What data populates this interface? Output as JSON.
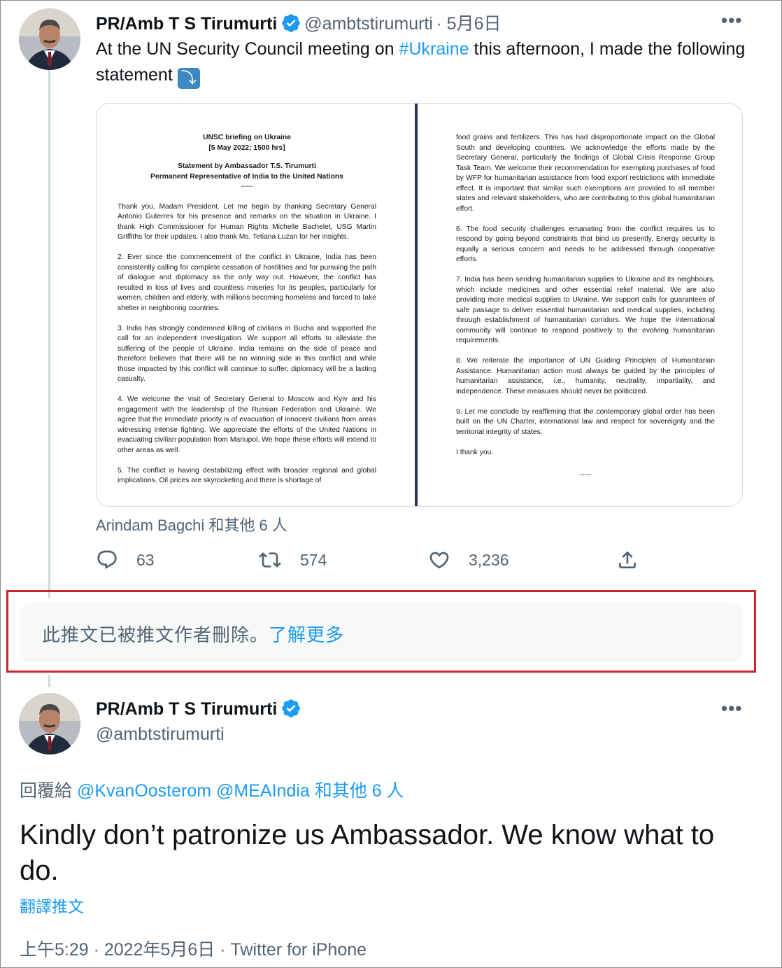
{
  "tweet1": {
    "name": "PR/Amb T S Tirumurti",
    "handle": "@ambtstirumurti",
    "date": "· 5月6日",
    "text_before": "At the UN Security Council meeting on ",
    "hashtag": "#Ukraine",
    "text_after": " this afternoon, I made the following statement ",
    "emoji": "⤵️",
    "tagged": "Arindam Bagchi 和其他 6 人",
    "replies": "63",
    "retweets": "574",
    "likes": "3,236",
    "icons": [
      "verified-badge-icon",
      "more-icon",
      "reply-icon",
      "retweet-icon",
      "like-icon",
      "share-icon"
    ]
  },
  "document": {
    "left": {
      "heading1": "UNSC briefing on Ukraine",
      "heading2": "[5 May 2022; 1500 hrs]",
      "heading3": "Statement by Ambassador T.S. Tirumurti",
      "heading4": "Permanent Representative of India to the United Nations",
      "dash": "-----",
      "p1": "        Thank you, Madam President. Let me begin by thanking Secretary General Antonio Guterres for his presence and remarks on the situation in Ukraine. I thank High Commissioner for Human Rights Michelle Bachelet, USG Martin Griffiths for their updates. I also thank Ms. Tetiana Luzan for her insights.",
      "p2": "2.      Ever since the commencement of the conflict in Ukraine, India has been consistently calling for complete cessation of hostilities and for pursuing the path of dialogue and diplomacy as the only way out. However, the conflict has resulted in loss of lives and countless miseries for its peoples, particularly for women, children and elderly, with millions becoming homeless and forced to take shelter in neighboring countries.",
      "p3": "3.      India has strongly condemned killing of civilians in Bucha and supported the call for an independent investigation. We support all efforts to alleviate the suffering of the people of Ukraine. India remains on the side of peace and therefore believes that there will be no winning side in this conflict and while those impacted by this conflict will continue to suffer, diplomacy will be a lasting casualty.",
      "p4": "4.      We welcome the visit of Secretary General to Moscow and Kyiv and his engagement with the leadership of the Russian Federation and Ukraine. We agree that the immediate priority is of evacuation of innocent civilians from areas witnessing intense fighting. We appreciate the efforts of the United Nations in evacuating civilian population from Mariupol. We hope these efforts will extend to other areas as well.",
      "p5": "5.      The conflict is having destabilizing effect with broader regional and global implications. Oil prices are skyrocketing and there is shortage of"
    },
    "right": {
      "p1": "food grains and fertilizers. This has had disproportionate impact on the Global South and developing countries. We acknowledge the efforts made by the Secretary General, particularly the findings of Global Crisis Response Group Task Team. We welcome their recommendation for exempting purchases of food by WFP for humanitarian assistance from food export restrictions with immediate effect. It is important that similar such exemptions are provided to all member states and relevant stakeholders, who are contributing to this global humanitarian effort.",
      "p6": "6.      The food security challenges emanating from the conflict requires us to respond by going beyond constraints that bind us presently. Energy security is equally a serious concern and needs to be addressed through cooperative efforts.",
      "p7": "7.      India has been sending humanitarian supplies to Ukraine and its neighbours, which include medicines and other essential relief material. We are also providing more medical supplies to Ukraine. We support calls for guarantees of safe passage to deliver essential humanitarian and medical supplies, including through establishment of humanitarian corridors. We hope the international community will continue to respond positively to the evolving humanitarian requirements.",
      "p8": "8.      We reiterate the importance of UN Guiding Principles of Humanitarian Assistance. Humanitarian action must always be guided by the principles of humanitarian assistance, i.e., humanity, neutrality, impartiality, and independence. These measures should never be politicized.",
      "p9": "9.      Let me conclude by reaffirming that the contemporary global order has been built on the UN Charter, international law and respect for sovereignty and the territorial integrity of states.",
      "thanks": "I thank you.",
      "end": "-----"
    }
  },
  "deleted": {
    "text": "此推文已被推文作者刪除。",
    "link": "了解更多"
  },
  "tweet2": {
    "name": "PR/Amb T S Tirumurti",
    "handle": "@ambtstirumurti",
    "reply_prefix": "回覆給 ",
    "mention1": "@KvanOosterom",
    "mention2": "@MEAIndia",
    "reply_suffix": " 和其他 6 人",
    "text": "Kindly don’t patronize us Ambassador. We know what to do.",
    "translate": "翻譯推文",
    "timestamp": "上午5:29 · 2022年5月6日 · Twitter for iPhone"
  },
  "colors": {
    "accent": "#1d9bf0",
    "secondary_text": "#536471",
    "highlight_border": "#c62828"
  }
}
